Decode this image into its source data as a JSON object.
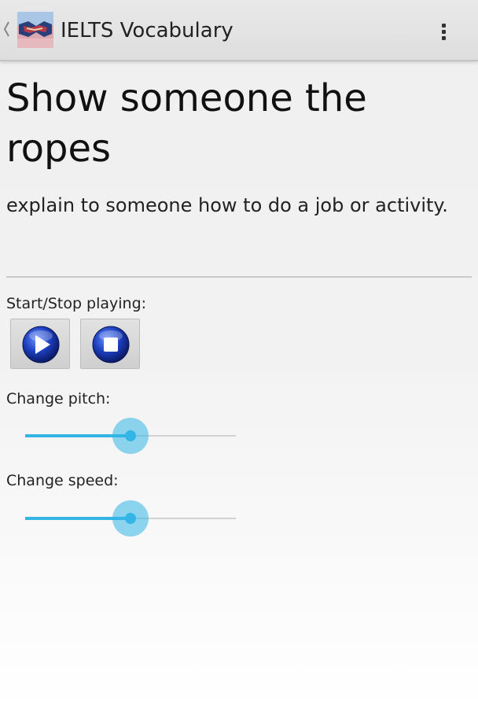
{
  "action_bar": {
    "title": "IELTS Vocabulary",
    "up_icon": "chevron-left-icon",
    "app_icon": "handshake-icon",
    "overflow_icon": "vertical-dots-icon"
  },
  "entry": {
    "headword": "Show someone the ropes",
    "definition": "explain to someone how to do a job or activity."
  },
  "playback": {
    "label": "Start/Stop playing:",
    "play_icon": "play-icon",
    "stop_icon": "stop-icon"
  },
  "pitch": {
    "label": "Change pitch:",
    "level": 0.5
  },
  "speed": {
    "label": "Change speed:",
    "level": 0.5
  },
  "colors": {
    "accent": "#33b5e5",
    "media_icon": "#1c3fbf"
  }
}
